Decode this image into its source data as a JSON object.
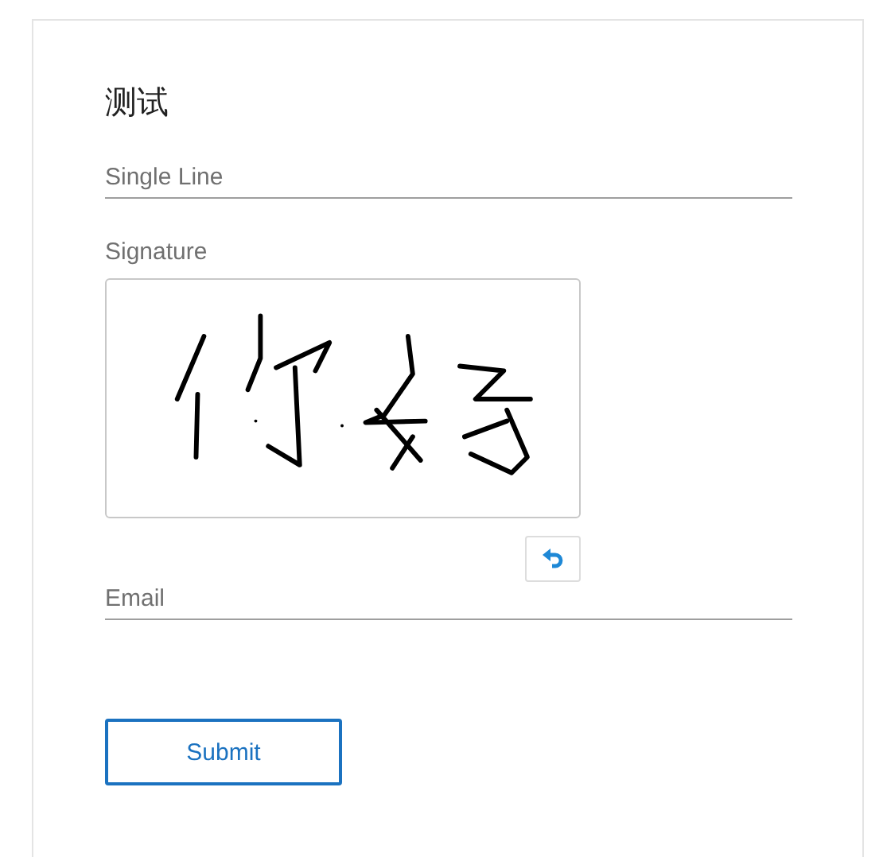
{
  "form": {
    "title": "测试",
    "fields": [
      {
        "kind": "text",
        "placeholder": "Single Line"
      },
      {
        "kind": "signature",
        "label": "Signature"
      },
      {
        "kind": "text",
        "placeholder": "Email"
      }
    ],
    "submit": "Submit"
  }
}
